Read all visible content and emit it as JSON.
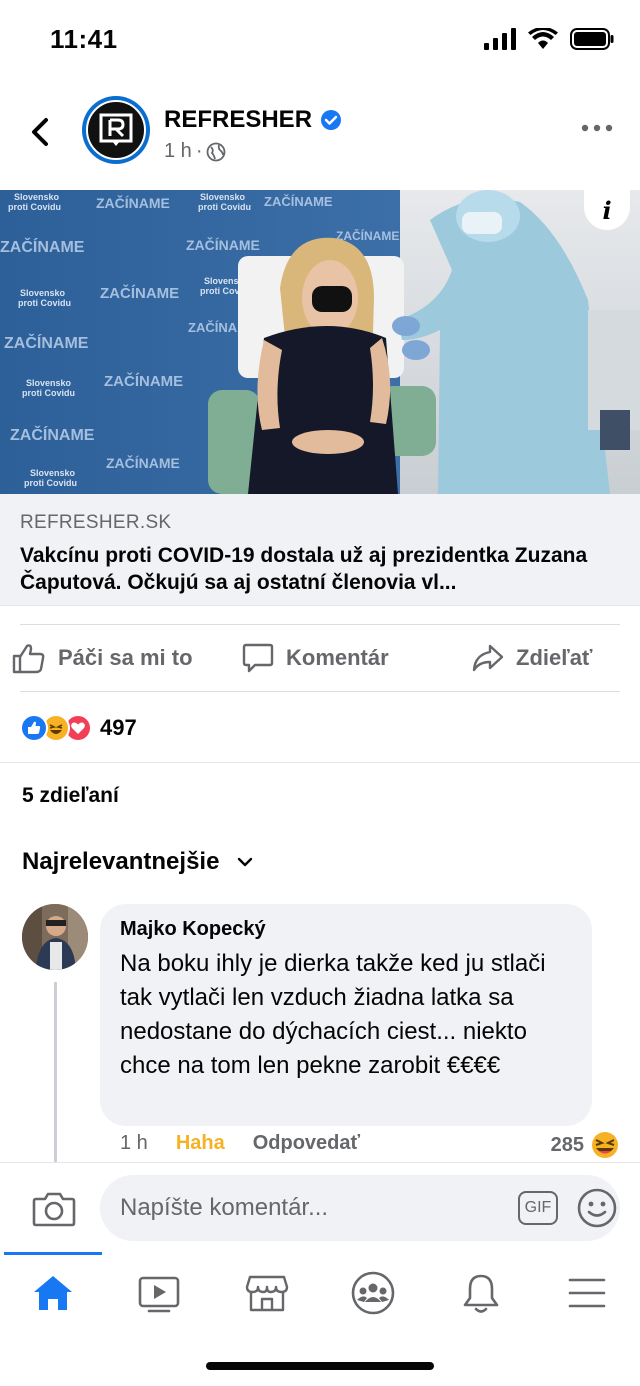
{
  "status_bar": {
    "time": "11:41"
  },
  "post": {
    "page_name": "REFRESHER",
    "verified": true,
    "time": "1 h",
    "separator": "·"
  },
  "link": {
    "image_texts": {
      "slogan": "ZAČÍNAME",
      "campaign_line1": "Slovensko",
      "campaign_line2": "proti Covidu"
    },
    "domain": "REFRESHER.SK",
    "title": "Vakcínu proti COVID-19 dostala už aj prezidentka Zuzana Čaputová. Očkujú sa aj ostatní členovia vl..."
  },
  "actions": {
    "like": "Páči sa mi to",
    "comment": "Komentár",
    "share": "Zdieľať"
  },
  "reactions": {
    "types": [
      "like",
      "haha",
      "love"
    ],
    "count": "497"
  },
  "shares_text": "5 zdieľaní",
  "sort_label": "Najrelevantnejšie",
  "comment": {
    "author": "Majko Kopecký",
    "text": "Na boku ihly je dierka takže ked ju stlači tak vytlači len vzduch žiadna latka sa nedostane do dýchacích ciest... niekto chce na tom len pekne zarobit €€€€",
    "time": "1 h",
    "reaction_action": "Haha",
    "reply": "Odpovedať",
    "reaction_count": "285"
  },
  "composer": {
    "placeholder": "Napíšte komentár...",
    "gif_label": "GIF"
  },
  "tabs": [
    "home-icon",
    "video-icon",
    "marketplace-icon",
    "groups-icon",
    "notifications-icon",
    "menu-icon"
  ],
  "colors": {
    "accent": "#1877f2",
    "secondary_text": "#65676b",
    "haha": "#f7b125",
    "love": "#f33e58"
  }
}
